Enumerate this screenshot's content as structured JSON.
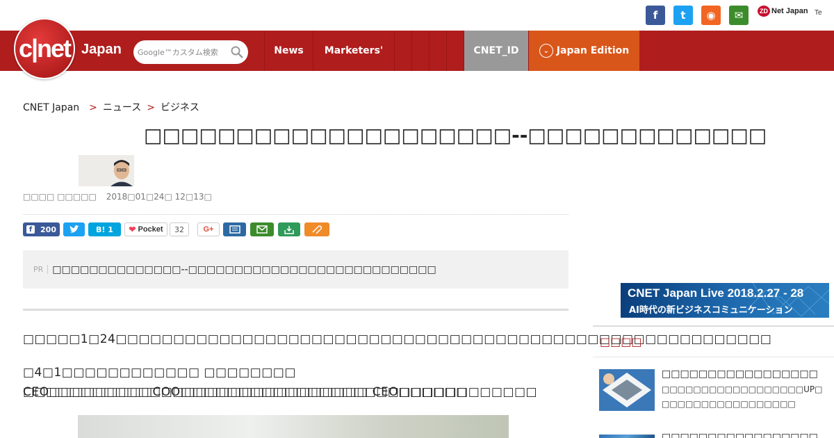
{
  "topbar": {
    "social": [
      {
        "name": "facebook-icon",
        "glyph": "f",
        "color": "#3b5998"
      },
      {
        "name": "twitter-icon",
        "glyph": "t",
        "color": "#1da1f2"
      },
      {
        "name": "rss-icon",
        "glyph": "◉",
        "color": "#f26522"
      },
      {
        "name": "mail-icon",
        "glyph": "✉",
        "color": "#3c8c2c"
      }
    ],
    "zdnet": "Net Japan",
    "zdnet_badge": "ZD",
    "tech": "Te"
  },
  "nav": {
    "logo": "c|net",
    "logo_sub": "Japan",
    "search_placeholder": "Google™カスタム検索",
    "items": [
      "News",
      "Marketers'"
    ],
    "cnet_id": "CNET_ID",
    "edition": "Japan Edition",
    "colors": {
      "brand": "#b01d1d",
      "edition": "#d9561a",
      "cnet_id": "#999999"
    }
  },
  "breadcrumb": [
    "CNET Japan",
    "ニュース",
    "ビジネス"
  ],
  "article": {
    "title": "□□□□□□□□□□□□□□□□□□□□--□□□□□□□□□□□□□",
    "author": "□□□□ □□□□□",
    "date": "2018□01□24□ 12□13□",
    "share": {
      "facebook_count": "200",
      "hatena": "B! 1",
      "pocket": "Pocket",
      "pocket_count": "32",
      "gplus": "G+"
    },
    "pr_tag": "PR",
    "pr_text": "□□□□□□□□□□□□□□--□□□□□□□□□□□□□□□□□□□□□□□□□□□",
    "para1": "□□□□□1□24□□□□□□□□□□□□□□□□□□□□□□□□□□□□□□□□□□□□□□□□□□□□□□□□□□□□□□□□□",
    "para2_line1": "□4□1□□□□□□□□□□□□ □□□□□□□□ □□□□□□□□□□□□□□□□□□□□□□□□□□□□□□ CEO□□□□□□",
    "para2_line2": "CEO□□□□□□□□□COO□□□□□□□□□□□□□□□□□□□□□□□□□□□□□□□"
  },
  "sidebar": {
    "banner_title": "CNET Japan Live 2018.2.27 - 28",
    "banner_sub": "AI時代の新ビジネスコミュニケーション",
    "heading": "□□□□",
    "items": [
      {
        "title": "□□□□□□□□□□□□□□□□□",
        "sub1": "□□□□□□□□□□□□□□□□□□UP□",
        "sub2": "□□□□□□□□□□□□□□□□□"
      },
      {
        "title": "□□□□□□□□□□□□□□□□□"
      }
    ]
  }
}
